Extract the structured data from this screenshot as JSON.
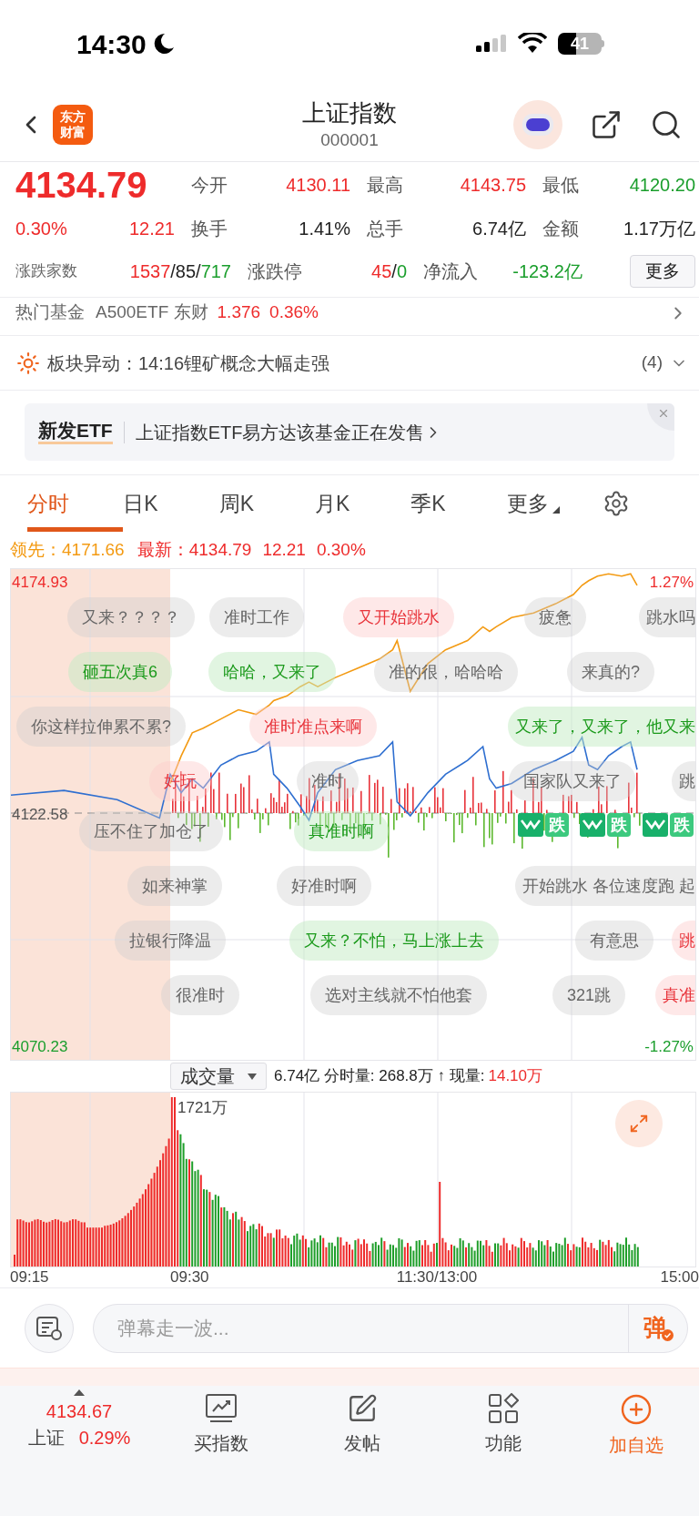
{
  "status_bar": {
    "time": "14:30",
    "battery": "41"
  },
  "header": {
    "logo": [
      "东方",
      "财富"
    ],
    "title": "上证指数",
    "code": "000001"
  },
  "quote": {
    "price": "4134.79",
    "change_pct": "0.30%",
    "change": "12.21",
    "color": "#ee2b2b",
    "stats": [
      {
        "label": "今开",
        "value": "4130.11",
        "color": "#ee2b2b"
      },
      {
        "label": "最高",
        "value": "4143.75",
        "color": "#ee2b2b"
      },
      {
        "label": "最低",
        "value": "4120.20",
        "color": "#1a9e2c"
      },
      {
        "label": "换手",
        "value": "1.41%",
        "color": "#222222"
      },
      {
        "label": "总手",
        "value": "6.74亿",
        "color": "#222222"
      },
      {
        "label": "金额",
        "value": "1.17万亿",
        "color": "#222222"
      }
    ],
    "breadth": [
      {
        "label": "涨跌家数",
        "parts": [
          {
            "text": "1537",
            "color": "#ee2b2b"
          },
          {
            "text": "/85/",
            "color": "#222222"
          },
          {
            "text": "717",
            "color": "#1a9e2c"
          }
        ]
      },
      {
        "label": "涨跌停",
        "parts": [
          {
            "text": "45",
            "color": "#ee2b2b"
          },
          {
            "text": "/",
            "color": "#222222"
          },
          {
            "text": "0",
            "color": "#1a9e2c"
          }
        ]
      },
      {
        "label": "净流入",
        "parts": [
          {
            "text": "-123.2亿",
            "color": "#1a9e2c"
          }
        ]
      }
    ],
    "more_button": "更多"
  },
  "hot_fund": {
    "label": "热门基金",
    "name": "A500ETF 东财",
    "price": "1.376",
    "change_pct": "0.36%",
    "color": "#ee2b2b"
  },
  "sector_alert": {
    "text": "板块异动：14:16锂矿概念大幅走强",
    "count": "(4)"
  },
  "etf_banner": {
    "tag": "新发ETF",
    "text": "上证指数ETF易方达该基金正在发售"
  },
  "tabs": [
    {
      "label": "分时",
      "selected": true,
      "kind": "tab"
    },
    {
      "label": "日K",
      "selected": false,
      "kind": "tab"
    },
    {
      "label": "周K",
      "selected": false,
      "kind": "tab"
    },
    {
      "label": "月K",
      "selected": false,
      "kind": "tab"
    },
    {
      "label": "季K",
      "selected": false,
      "kind": "tab"
    },
    {
      "label": "更多",
      "selected": false,
      "kind": "menu"
    }
  ],
  "leader_line": {
    "lead_label": "领先：",
    "lead_value": "4171.66",
    "latest_label": "最新：",
    "latest_value": "4134.79",
    "change": "12.21",
    "change_pct": "0.30%"
  },
  "intraday_chart": {
    "price_labels": [
      "4174.93",
      "4122.58",
      "4070.23"
    ],
    "right_labels": [
      "1.27%",
      "-1.27%"
    ],
    "danmaku": [
      {
        "text": "又来？？？？",
        "kind": "plain"
      },
      {
        "text": "准时工作",
        "kind": "plain"
      },
      {
        "text": "又开始跳水",
        "kind": "red"
      },
      {
        "text": "疲惫",
        "kind": "plain"
      },
      {
        "text": "跳水吗",
        "kind": "plain"
      },
      {
        "text": "砸五次真6",
        "kind": "green"
      },
      {
        "text": "哈哈，又来了",
        "kind": "green"
      },
      {
        "text": "准的很，哈哈哈",
        "kind": "plain"
      },
      {
        "text": "来真的?",
        "kind": "plain"
      },
      {
        "text": "你这样拉伸累不累?",
        "kind": "plain"
      },
      {
        "text": "准时准点来啊",
        "kind": "red"
      },
      {
        "text": "又来了，又来了，他又来",
        "kind": "green"
      },
      {
        "text": "好玩",
        "kind": "red"
      },
      {
        "text": "准时",
        "kind": "plain"
      },
      {
        "text": "国家队又来了",
        "kind": "plain"
      },
      {
        "text": "跳",
        "kind": "plain"
      },
      {
        "text": "压不住了加仓了",
        "kind": "plain"
      },
      {
        "text": "真准时啊",
        "kind": "green"
      },
      {
        "text": "跌",
        "kind": "sticker"
      },
      {
        "text": "跌",
        "kind": "sticker"
      },
      {
        "text": "跌",
        "kind": "sticker"
      },
      {
        "text": "如来神掌",
        "kind": "plain"
      },
      {
        "text": "好准时啊",
        "kind": "plain"
      },
      {
        "text": "开始跳水 各位速度跑 起",
        "kind": "plain"
      },
      {
        "text": "拉银行降温",
        "kind": "plain"
      },
      {
        "text": "又来？不怕，马上涨上去",
        "kind": "green"
      },
      {
        "text": "有意思",
        "kind": "plain"
      },
      {
        "text": "跳",
        "kind": "red"
      },
      {
        "text": "很准时",
        "kind": "plain"
      },
      {
        "text": "选对主线就不怕他套",
        "kind": "plain"
      },
      {
        "text": "321跳",
        "kind": "plain"
      },
      {
        "text": "真准",
        "kind": "red"
      }
    ]
  },
  "volume": {
    "selector": "成交量",
    "summary": "6.74亿 分时量: 268.8万 ↑ 现量:",
    "current": "14.10万",
    "peak_label": "1721万",
    "time_labels": [
      "09:15",
      "09:30",
      "11:30/13:00",
      "15:00"
    ]
  },
  "danmaku_input": {
    "placeholder": "弹幕走一波...",
    "send": "弹"
  },
  "bottom_nav": {
    "index": {
      "value": "4134.67",
      "name": "上证",
      "change_pct": "0.29%",
      "color": "#ee2b2b"
    },
    "items": [
      {
        "label": "买指数",
        "kind": "buy"
      },
      {
        "label": "发帖",
        "kind": "post"
      },
      {
        "label": "功能",
        "kind": "tools"
      },
      {
        "label": "加自选",
        "kind": "add"
      }
    ]
  }
}
